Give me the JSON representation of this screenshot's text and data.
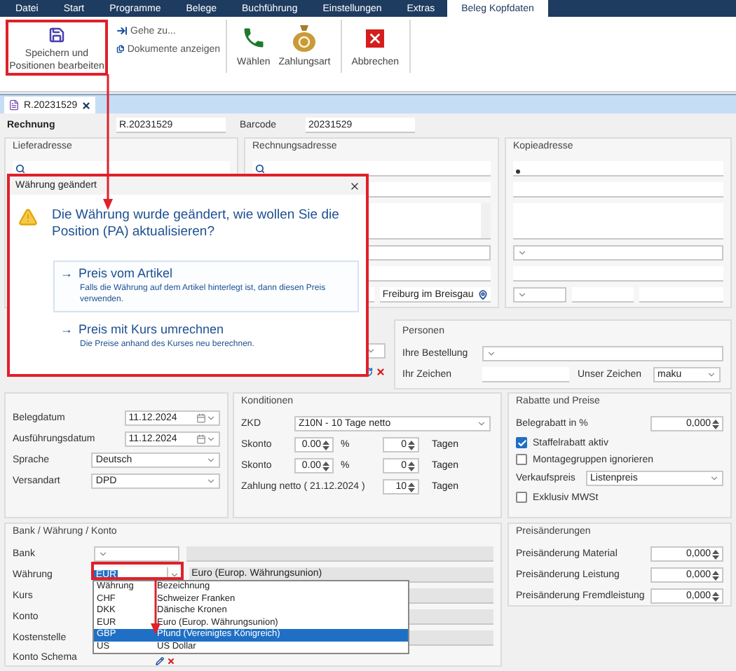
{
  "menu_tabs": [
    {
      "label": "Datei",
      "selected": false
    },
    {
      "label": "Start",
      "selected": false
    },
    {
      "label": "Programme",
      "selected": false
    },
    {
      "label": "Belege",
      "selected": false
    },
    {
      "label": "Buchführung",
      "selected": false
    },
    {
      "label": "Einstellungen",
      "selected": false
    },
    {
      "label": "Extras",
      "selected": false
    },
    {
      "label": "Beleg Kopfdaten",
      "selected": true
    }
  ],
  "ribbon": {
    "save": {
      "label": "Speichern und Positionen bearbeiten"
    },
    "links": [
      {
        "label": "Gehe zu..."
      },
      {
        "label": "Dokumente anzeigen"
      }
    ],
    "buttons": [
      {
        "label": "Wählen"
      },
      {
        "label": "Zahlungsart"
      },
      {
        "label": "Abbrechen"
      }
    ]
  },
  "document_tab": {
    "label": "R.20231529"
  },
  "header": {
    "type_label": "Rechnung",
    "number": "R.20231529",
    "barcode_label": "Barcode",
    "barcode": "20231529"
  },
  "addresses": [
    {
      "title": "Lieferadresse"
    },
    {
      "title": "Rechnungsadresse",
      "city": "Freiburg im Breisgau"
    },
    {
      "title": "Kopieadresse"
    }
  ],
  "dialog": {
    "title": "Währung geändert",
    "message": "Die Währung wurde geändert, wie wollen Sie die Position (PA) aktualisieren?",
    "options": [
      {
        "arrow": "→",
        "title": "Preis vom Artikel",
        "description": "Falls die Währung auf dem Artikel hinterlegt ist, dann diesen Preis verwenden.",
        "selected": true
      },
      {
        "arrow": "→",
        "title": "Preis mit Kurs umrechnen",
        "description": "Die Preise anhand des Kurses neu berechnen.",
        "selected": false
      }
    ]
  },
  "personen": {
    "title": "Personen",
    "bestellung_label": "Ihre Bestellung",
    "zeichen_label": "Ihr Zeichen",
    "unser_label": "Unser Zeichen",
    "unser_value": "maku"
  },
  "belegdaten": [
    {
      "label": "Belegdatum",
      "value": "11.12.2024",
      "kind": "date"
    },
    {
      "label": "Ausführungsdatum",
      "value": "11.12.2024",
      "kind": "date"
    },
    {
      "label": "Sprache",
      "value": "Deutsch",
      "kind": "select"
    },
    {
      "label": "Versandart",
      "value": "DPD",
      "kind": "select"
    }
  ],
  "konditionen": {
    "title": "Konditionen",
    "zkd_label": "ZKD",
    "zkd": "Z10N - 10 Tage netto",
    "skonto": [
      {
        "label": "Skonto",
        "percent": "0.00",
        "percent_unit": "%",
        "days": "0",
        "days_unit": "Tagen"
      },
      {
        "label": "Skonto",
        "percent": "0.00",
        "percent_unit": "%",
        "days": "0",
        "days_unit": "Tagen"
      }
    ],
    "netto_label": "Zahlung netto ( 21.12.2024 )",
    "netto_days": "10",
    "netto_unit": "Tagen"
  },
  "rabatte": {
    "title": "Rabatte und Preise",
    "belegrabatt_label": "Belegrabatt in %",
    "belegrabatt": "0,000",
    "checks": [
      {
        "label": "Staffelrabatt aktiv",
        "checked": true
      },
      {
        "label": "Montagegruppen ignorieren",
        "checked": false
      }
    ],
    "verkaufspreis_label": "Verkaufspreis",
    "verkaufspreis": "Listenpreis",
    "exklusiv": {
      "label": "Exklusiv MWSt",
      "checked": false
    }
  },
  "bank": {
    "title": "Bank / Währung / Konto",
    "fields": [
      {
        "label": "Bank",
        "kind": "select"
      },
      {
        "label": "Währung",
        "kind": "currency",
        "value": "EUR",
        "description": "Euro (Europ. Währungsunion)"
      },
      {
        "label": "Kurs",
        "kind": "wide"
      },
      {
        "label": "Konto",
        "kind": "wide"
      },
      {
        "label": "Kostenstelle",
        "kind": "wide"
      },
      {
        "label": "Konto Schema",
        "kind": "tools"
      }
    ]
  },
  "currency_dropdown": {
    "columns": [
      "Währung",
      "Bezeichnung"
    ],
    "rows": [
      {
        "code": "CHF",
        "name": "Schweizer Franken",
        "selected": false
      },
      {
        "code": "DKK",
        "name": "Dänische Kronen",
        "selected": false
      },
      {
        "code": "EUR",
        "name": "Euro (Europ. Währungsunion)",
        "selected": false
      },
      {
        "code": "GBP",
        "name": "Pfund (Vereinigtes Königreich)",
        "selected": true
      },
      {
        "code": "US",
        "name": "US Dollar",
        "selected": false
      }
    ]
  },
  "preisaenderungen": {
    "title": "Preisänderungen",
    "rows": [
      {
        "label": "Preisänderung Material",
        "value": "0,000"
      },
      {
        "label": "Preisänderung Leistung",
        "value": "0,000"
      },
      {
        "label": "Preisänderung Fremdleistung",
        "value": "0,000"
      }
    ]
  }
}
